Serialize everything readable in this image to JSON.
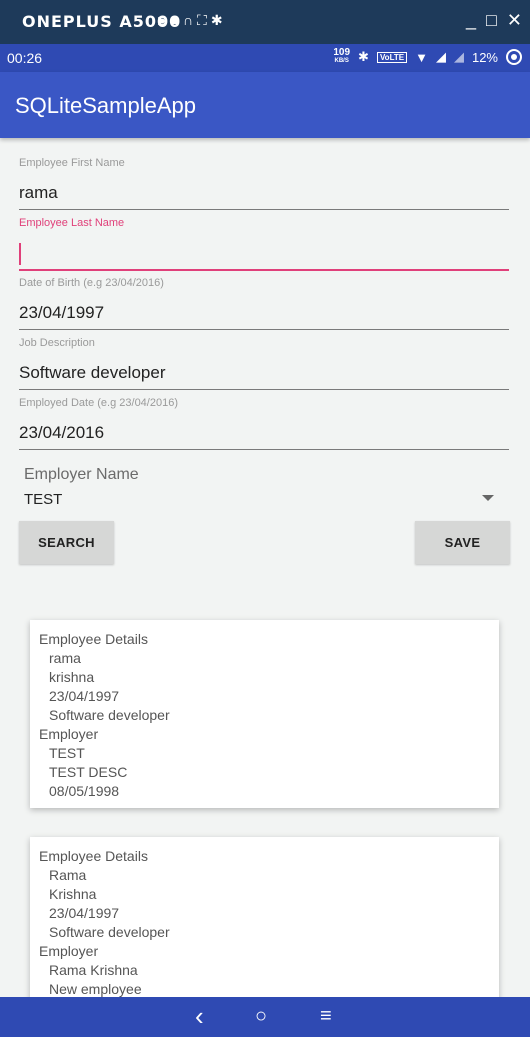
{
  "window": {
    "device_name": "ONEPLUS A5000",
    "toolbar_icons": [
      "camera-icon",
      "video-icon",
      "headphones-icon",
      "fullscreen-icon",
      "settings-icon"
    ],
    "controls": [
      "minimize",
      "maximize",
      "close"
    ]
  },
  "status_bar": {
    "time": "00:26",
    "speed_value": "109",
    "speed_unit": "KB/S",
    "volte": "VoLTE",
    "battery": "12%"
  },
  "app_bar": {
    "title": "SQLiteSampleApp"
  },
  "form": {
    "first_name": {
      "label": "Employee First Name",
      "value": "rama"
    },
    "last_name": {
      "label": "Employee Last Name",
      "value": ""
    },
    "dob": {
      "label": "Date of Birth (e.g 23/04/2016)",
      "value": "23/04/1997"
    },
    "job": {
      "label": "Job Description",
      "value": "Software developer"
    },
    "employed": {
      "label": "Employed Date (e.g 23/04/2016)",
      "value": "23/04/2016"
    },
    "employer": {
      "label": "Employer Name",
      "selected": "TEST"
    }
  },
  "buttons": {
    "search": "SEARCH",
    "save": "SAVE"
  },
  "cards": [
    {
      "header": "Employee Details",
      "employee": [
        "rama",
        "krishna",
        "23/04/1997",
        "Software developer"
      ],
      "employer_header": "Employer",
      "employer": [
        "TEST",
        "TEST DESC",
        "08/05/1998"
      ]
    },
    {
      "header": "Employee Details",
      "employee": [
        "Rama",
        "Krishna",
        "23/04/1997",
        "Software developer"
      ],
      "employer_header": "Employer",
      "employer": [
        "Rama Krishna",
        "New employee"
      ]
    }
  ],
  "nav": {
    "back": "‹",
    "home": "○",
    "menu": "≡"
  },
  "colors": {
    "primary": "#3a57c5",
    "primary_dark": "#2f4ab3",
    "accent": "#e0407a",
    "window_bar": "#1e3a5a"
  }
}
